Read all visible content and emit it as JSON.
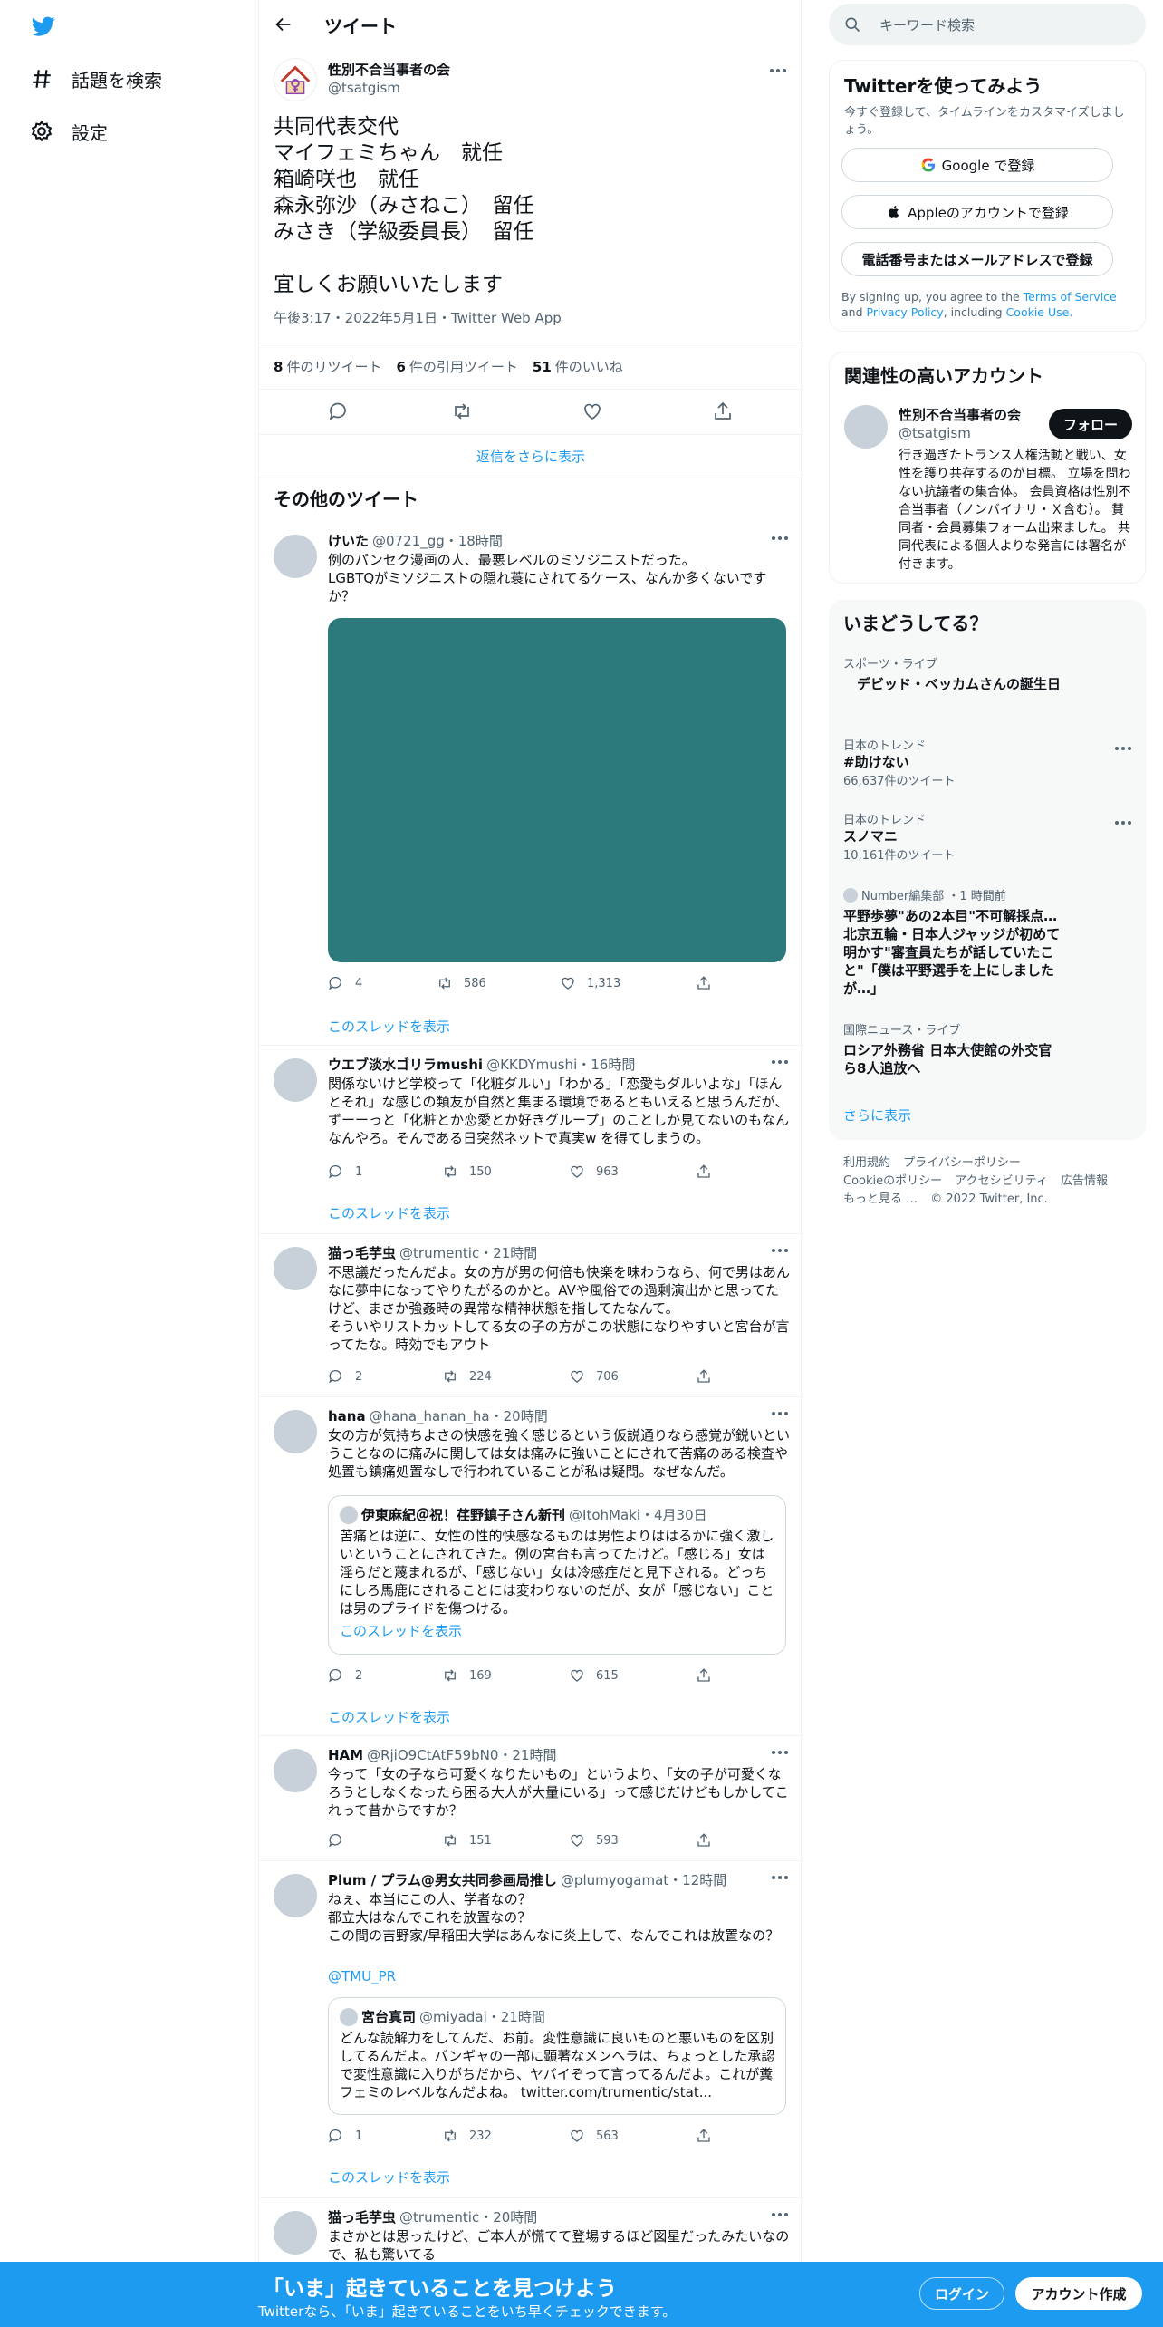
{
  "nav": {
    "explore": "話題を検索",
    "settings": "設定"
  },
  "header": {
    "title": "ツイート"
  },
  "main_tweet": {
    "author": "性別不合当事者の会",
    "handle": "@tsatgism",
    "text": "共同代表交代\nマイフェミちゃん　就任\n箱崎咲也　就任\n森永弥沙（みさねこ）　留任\nみさき（学級委員長）　留任\n\n宜しくお願いいたします",
    "meta": "午後3:17・2022年5月1日・Twitter Web App",
    "retweets_count": "8",
    "retweets_label": "件のリツイート",
    "quotes_count": "6",
    "quotes_label": "件の引用ツイート",
    "likes_count": "51",
    "likes_label": "件のいいね",
    "show_more_replies": "返信をさらに表示"
  },
  "other_title": "その他のツイート",
  "thread_label": "このスレッドを表示",
  "tweets": [
    {
      "name": "けいた",
      "meta": "@0721_gg・18時間",
      "text": "例のパンセク漫画の人、最悪レベルのミソジニストだった。\nLGBTQがミソジニストの隠れ蓑にされてるケース、なんか多くないですか？",
      "reply": "4",
      "retweet": "586",
      "like": "1,313"
    },
    {
      "name": "ウエブ淡水ゴリラmushi",
      "meta": "@KKDYmushi・16時間",
      "text": "関係ないけど学校って「化粧ダルい」「わかる」「恋愛もダルいよな」「ほんとそれ」な感じの類友が自然と集まる環境であるともいえると思うんだが、ずーーっと「化粧とか恋愛とか好きグループ」のことしか見てないのもなんなんやろ。そんである日突然ネットで真実w を得てしまうの。",
      "reply": "1",
      "retweet": "150",
      "like": "963"
    },
    {
      "name": "猫っ毛芋虫",
      "meta": "@trumentic・21時間",
      "text": "不思議だったんだよ。女の方が男の何倍も快楽を味わうなら、何で男はあんなに夢中になってやりたがるのかと。AVや風俗での過剰演出かと思ってたけど、まさか強姦時の異常な精神状態を指してたなんて。\nそういやリストカットしてる女の子の方がこの状態になりやすいと宮台が言ってたな。時効でもアウト",
      "reply": "2",
      "retweet": "224",
      "like": "706"
    },
    {
      "name": "hana",
      "meta": "@hana_hanan_ha・20時間",
      "text": "女の方が気持ちよさの快感を強く感じるという仮説通りなら感覚が鋭いということなのに痛みに関しては女は痛みに強いことにされて苦痛のある検査や処置も鎮痛処置なしで行われていることが私は疑問。なぜなんだ。",
      "quote_name": "伊東麻紀＠祝！荏野鎮子さん新刊",
      "quote_meta": "@ItohMaki・4月30日",
      "quote_text": "苦痛とは逆に、女性の性的快感なるものは男性よりははるかに強く激しいということにされてきた。例の宮台も言ってたけど。「感じる」女は淫らだと蔑まれるが、「感じない」女は冷感症だと見下される。どっちにしろ馬鹿にされることには変わりないのだが、女が「感じない」ことは男のプライドを傷つける。",
      "reply": "2",
      "retweet": "169",
      "like": "615"
    },
    {
      "name": "HAM",
      "meta": "@RjiO9CtAtF59bN0・21時間",
      "text": "今って「女の子なら可愛くなりたいもの」というより、「女の子が可愛くなろうとしなくなったら困る大人が大量にいる」って感じだけどもしかしてこれって昔からですか？",
      "reply": "",
      "retweet": "151",
      "like": "593"
    },
    {
      "name": "Plum / プラム@男女共同参画局推し",
      "meta": "@plumyogamat・12時間",
      "text": "ねぇ、本当にこの人、学者なの？\n都立大はなんでこれを放置なの？\nこの間の吉野家/早稲田大学はあんなに炎上して、なんでこれは放置なの？",
      "mention": "@TMU_PR",
      "quote_name": "宮台真司",
      "quote_meta": "@miyadai・21時間",
      "quote_text": "どんな読解力をしてんだ、お前。変性意識に良いものと悪いものを区別してるんだよ。バンギャの一部に顕著なメンヘラは、ちょっとした承認で変性意識に入りがちだから、ヤバイぞって言ってるんだよ。これが糞フェミのレベルなんだよね。 twitter.com/trumentic/stat...",
      "reply": "1",
      "retweet": "232",
      "like": "563"
    },
    {
      "name": "猫っ毛芋虫",
      "meta": "@trumentic・20時間",
      "text": "まさかとは思ったけど、ご本人が慌てて登場するほど図星だったみたいなので、私も驚いてる"
    }
  ],
  "right": {
    "search_placeholder": "キーワード検索",
    "signup_title": "Twitterを使ってみよう",
    "signup_sub": "今すぐ登録して、タイムラインをカスタマイズしましょう。",
    "google_btn": "Google で登録",
    "apple_btn": "Appleのアカウントで登録",
    "phone_btn": "電話番号またはメールアドレスで登録",
    "legal_pre": "By signing up, you agree to the",
    "legal_terms": "Terms of Service",
    "legal_and": "and",
    "legal_privacy": "Privacy Policy",
    "legal_including": ", including",
    "legal_cookie": "Cookie Use.",
    "related_title": "関連性の高いアカウント",
    "related_name": "性別不合当事者の会",
    "related_handle": "@tsatgism",
    "follow_label": "フォロー",
    "related_bio": "行き過ぎたトランス人権活動と戦い、女性を護り共存するのが目標。 立場を問わない抗議者の集合体。 会員資格は性別不合当事者（ノンバイナリ・Ｘ含む）。 賛同者・会員募集フォーム出来ました。 共同代表による個人よりな発言には署名が付きます。",
    "trends_title": "いまどうしてる？",
    "trends": [
      {
        "cat": "スポーツ・ライブ",
        "name": "　デビッド・ベッカムさんの誕生日",
        "cnt": ""
      },
      {
        "cat": "日本のトレンド",
        "name": "#助けない",
        "cnt": "66,637件のツイート"
      },
      {
        "cat": "日本のトレンド",
        "name": "スノマニ",
        "cnt": "10,161件のツイート"
      },
      {
        "cat": "Number編集部 ・1 時間前",
        "name": "平野歩夢\"あの2本目\"不可解採点…北京五輪・日本人ジャッジが初めて明かす\"審査員たちが話していたこと\"「僕は平野選手を上にしましたが…」",
        "cnt": ""
      },
      {
        "cat": "国際ニュース・ライブ",
        "name": "ロシア外務省 日本大使館の外交官ら8人追放へ",
        "cnt": ""
      }
    ],
    "trends_more": "さらに表示",
    "footer": {
      "terms": "利用規約",
      "privacy": "プライバシーポリシー",
      "cookie": "Cookieのポリシー",
      "access": "アクセシビリティ",
      "ads": "広告情報",
      "more": "もっと見る …",
      "copy": "© 2022 Twitter, Inc."
    }
  },
  "bottom_bar": {
    "headline": "「いま」起きていることを見つけよう",
    "sub": "Twitterなら、「いま」起きていることをいち早くチェックできます。",
    "login": "ログイン",
    "signup": "アカウント作成"
  },
  "colors": {
    "accent": "#1d9bf0",
    "media": "#2c7a7b"
  }
}
